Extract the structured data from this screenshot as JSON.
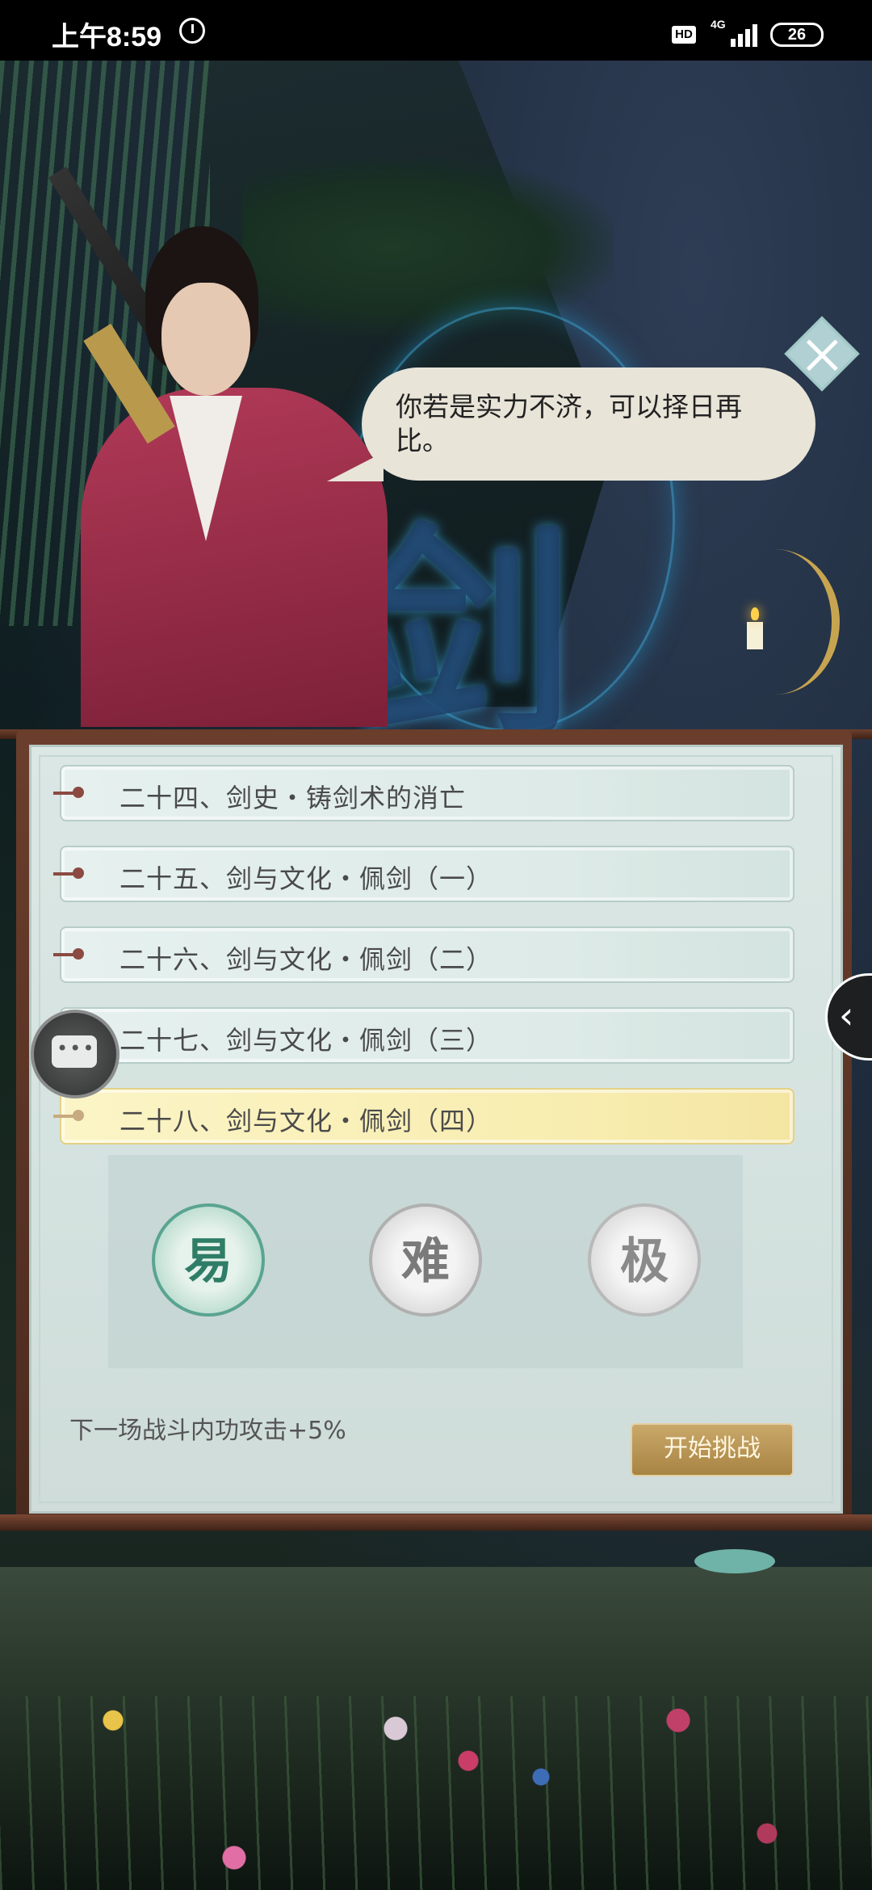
{
  "status_bar": {
    "time": "上午8:59",
    "hd": "HD",
    "network": "4G",
    "battery": "26"
  },
  "scene": {
    "background_glyph": "剑"
  },
  "dialog": {
    "speech": "你若是实力不济，可以择日再比。"
  },
  "chapters": [
    {
      "label": "二十四、剑史・铸剑术的消亡",
      "selected": false
    },
    {
      "label": "二十五、剑与文化・佩剑（一）",
      "selected": false
    },
    {
      "label": "二十六、剑与文化・佩剑（二）",
      "selected": false
    },
    {
      "label": "二十七、剑与文化・佩剑（三）",
      "selected": false
    },
    {
      "label": "二十八、剑与文化・佩剑（四）",
      "selected": true
    }
  ],
  "difficulty": {
    "easy": "易",
    "hard": "难",
    "extreme": "极",
    "selected": "easy"
  },
  "buff_text": "下一场战斗内功攻击+5%",
  "start_button": "开始挑战",
  "colors": {
    "panel_bg": "#d4e2df",
    "selected_chapter": "#f8edb0",
    "start_button": "#b8944f",
    "robe": "#b13a58"
  }
}
